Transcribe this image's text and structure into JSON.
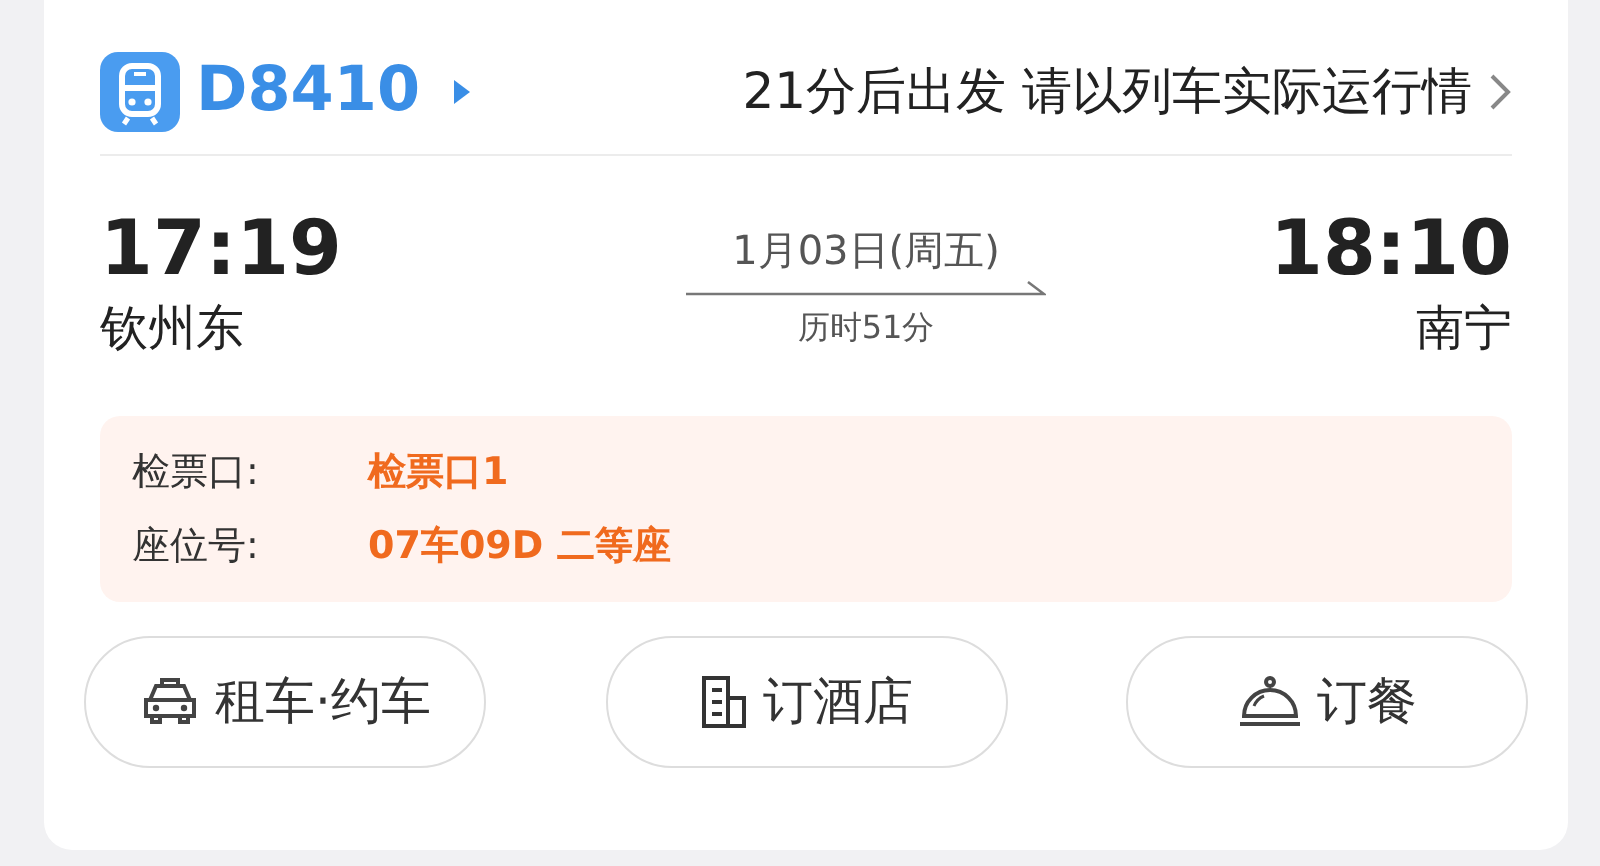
{
  "train": {
    "number": "D8410",
    "notice": "21分后出发 请以列车实际运行情"
  },
  "departure": {
    "time": "17:19",
    "station": "钦州东"
  },
  "journey": {
    "date": "1月03日(周五)",
    "duration": "历时51分"
  },
  "arrival": {
    "time": "18:10",
    "station": "南宁"
  },
  "details": [
    {
      "label": "检票口:",
      "value": "检票口1"
    },
    {
      "label": "座位号:",
      "value": "07车09D 二等座"
    }
  ],
  "actions": [
    {
      "kind": "car",
      "label": "租车·约车"
    },
    {
      "kind": "hotel",
      "label": "订酒店"
    },
    {
      "kind": "meal",
      "label": "订餐"
    }
  ]
}
